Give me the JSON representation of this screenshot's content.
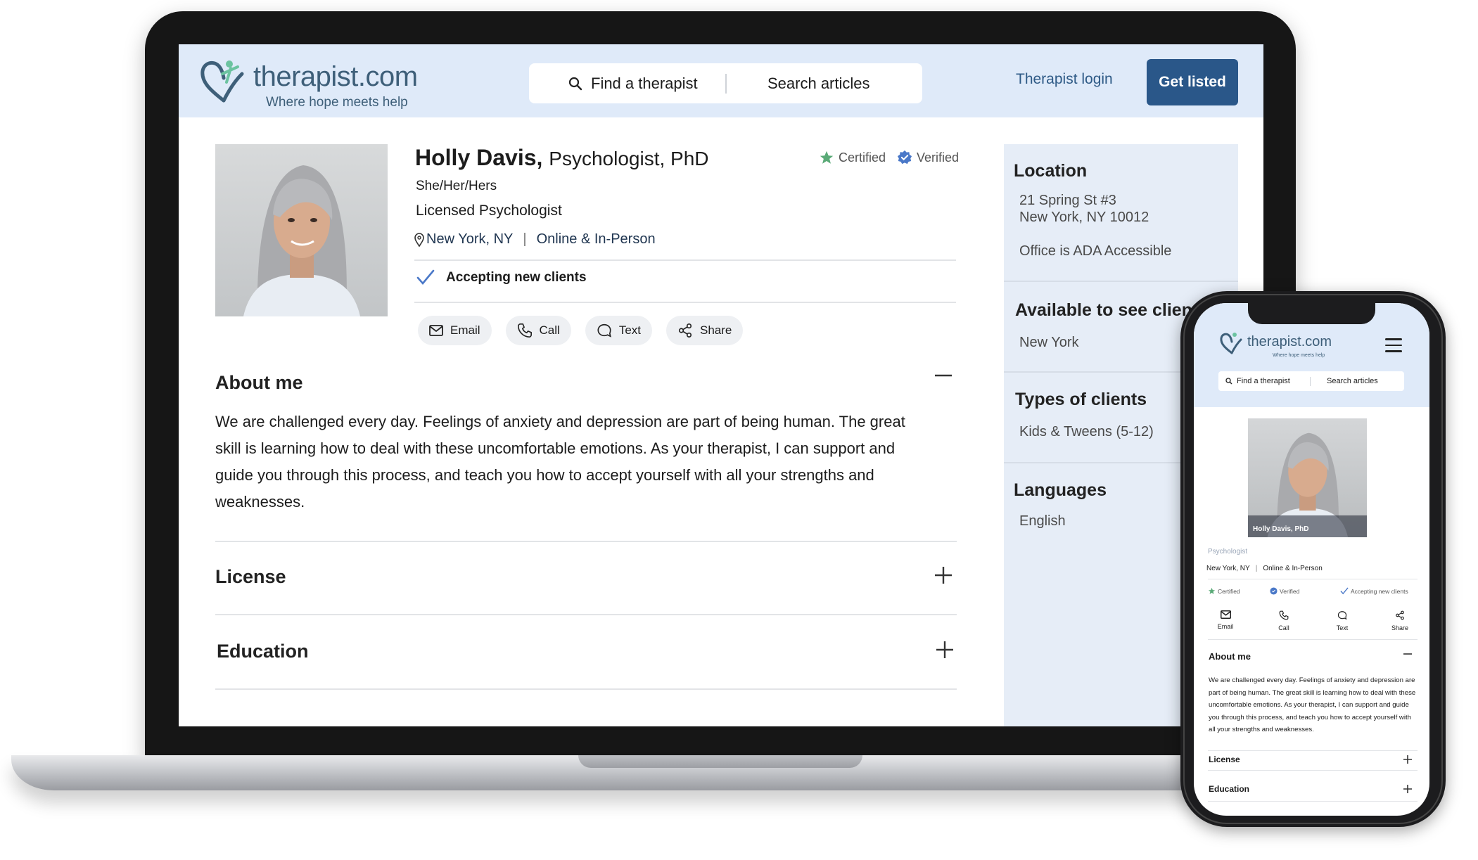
{
  "brand": {
    "name": "therapist.com",
    "tagline": "Where hope meets help"
  },
  "header": {
    "search_find": "Find a therapist",
    "search_articles": "Search articles",
    "login": "Therapist login",
    "cta": "Get listed"
  },
  "profile": {
    "name": "Holly Davis,",
    "credentials": "Psychologist, PhD",
    "pronouns": "She/Her/Hers",
    "title": "Licensed Psychologist",
    "location": "New York, NY",
    "separator": "|",
    "mode": "Online & In-Person",
    "badge_certified": "Certified",
    "badge_verified": "Verified",
    "accepting": "Accepting new clients",
    "actions": {
      "email": "Email",
      "call": "Call",
      "text": "Text",
      "share": "Share"
    }
  },
  "sections": {
    "about_title": "About me",
    "about_text": "We are challenged every day. Feelings of anxiety and depression  are part of being human. The great skill is learning how to deal with these uncomfortable emotions. As your therapist, I can support and guide you through this process, and teach you how  to accept yourself with all your strengths and weaknesses.",
    "license_title": "License",
    "education_title": "Education",
    "collapse_symbol": "—",
    "expand_symbol": "+"
  },
  "sidebar": {
    "location_title": "Location",
    "address_line1": "21 Spring St #3",
    "address_line2": "New York, NY 10012",
    "accessibility": "Office is ADA Accessible",
    "available_title": "Available to see clients",
    "available_value": "New York",
    "types_title": "Types of clients",
    "types_value": "Kids & Tweens (5-12)",
    "languages_title": "Languages",
    "languages_value": "English"
  },
  "mobile": {
    "photo_caption": "Holly Davis, PhD",
    "role": "Psychologist",
    "location": "New York, NY",
    "mode": "Online & In-Person",
    "certified": "Certified",
    "verified": "Verified",
    "accepting": "Accepting new clients",
    "about_text": "We are challenged every day. Feelings of anxiety and depression are part of being human. The great skill is learning how to deal with these uncomfortable emotions. As your therapist, I can support and guide you through this process, and teach you how to accept yourself with all your strengths and weaknesses."
  },
  "colors": {
    "header_bg": "#dfeaf9",
    "brand_text": "#3e5f79",
    "cta_bg": "#2a5789",
    "sidebar_bg": "#e6edf7",
    "accent_check": "#4a78c8",
    "certified_green": "#5aaa77"
  },
  "icons": [
    "search-icon",
    "location-pin-icon",
    "checkmark-icon",
    "mail-icon",
    "phone-icon",
    "chat-bubble-icon",
    "share-icon",
    "star-icon",
    "verified-seal-icon",
    "minus-icon",
    "plus-icon",
    "hamburger-menu-icon"
  ]
}
